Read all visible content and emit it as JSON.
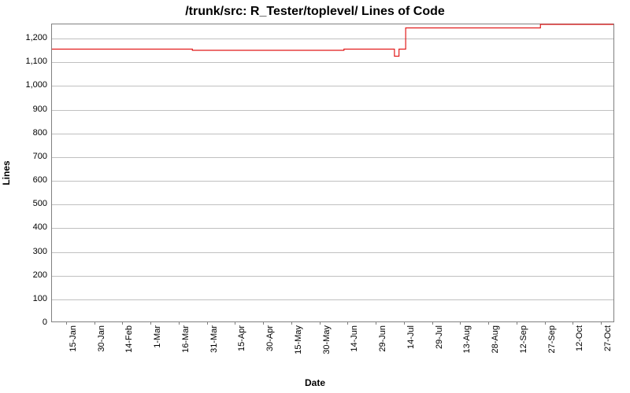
{
  "chart_data": {
    "type": "line",
    "title": "/trunk/src: R_Tester/toplevel/ Lines of Code",
    "xlabel": "Date",
    "ylabel": "Lines",
    "ylim": [
      0,
      1260
    ],
    "y_ticks": [
      0,
      100,
      200,
      300,
      400,
      500,
      600,
      700,
      800,
      900,
      1000,
      1100,
      1200
    ],
    "y_tick_labels": [
      "0",
      "100",
      "200",
      "300",
      "400",
      "500",
      "600",
      "700",
      "800",
      "900",
      "1,000",
      "1,100",
      "1,200"
    ],
    "x_tick_labels": [
      "15-Jan",
      "30-Jan",
      "14-Feb",
      "1-Mar",
      "16-Mar",
      "31-Mar",
      "15-Apr",
      "30-Apr",
      "15-May",
      "30-May",
      "14-Jun",
      "29-Jun",
      "14-Jul",
      "29-Jul",
      "13-Aug",
      "28-Aug",
      "12-Sep",
      "27-Sep",
      "12-Oct",
      "27-Oct"
    ],
    "line_color": "#e11b1b",
    "series": [
      {
        "name": "Lines of Code",
        "points": [
          {
            "x_frac": 0.0,
            "y": 1155
          },
          {
            "x_frac": 0.25,
            "y": 1155
          },
          {
            "x_frac": 0.25,
            "y": 1150
          },
          {
            "x_frac": 0.52,
            "y": 1150
          },
          {
            "x_frac": 0.52,
            "y": 1155
          },
          {
            "x_frac": 0.61,
            "y": 1155
          },
          {
            "x_frac": 0.61,
            "y": 1125
          },
          {
            "x_frac": 0.618,
            "y": 1125
          },
          {
            "x_frac": 0.618,
            "y": 1155
          },
          {
            "x_frac": 0.63,
            "y": 1155
          },
          {
            "x_frac": 0.63,
            "y": 1245
          },
          {
            "x_frac": 0.87,
            "y": 1245
          },
          {
            "x_frac": 0.87,
            "y": 1260
          },
          {
            "x_frac": 1.0,
            "y": 1260
          }
        ]
      }
    ]
  }
}
